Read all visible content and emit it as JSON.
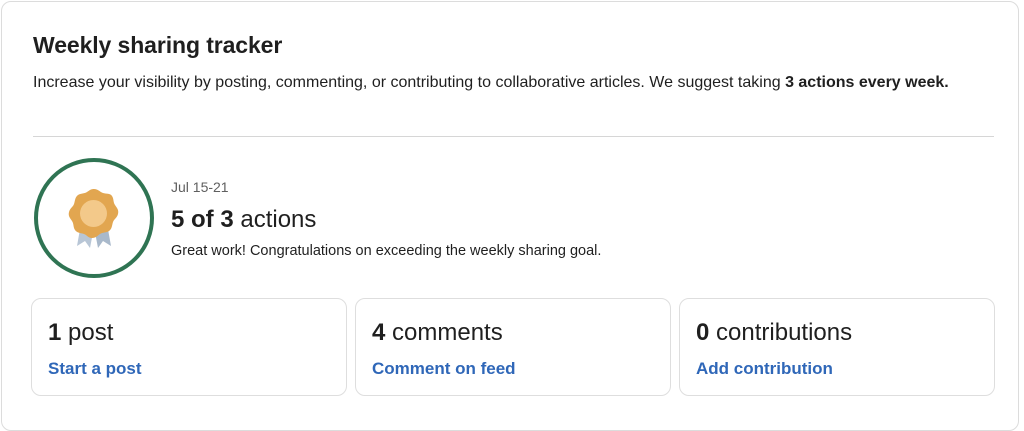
{
  "tracker": {
    "title": "Weekly sharing tracker",
    "description": "Increase your visibility by posting, commenting, or contributing to collaborative articles. We suggest taking ",
    "description_bold": "3 actions every week.",
    "period": "Jul 15-21",
    "actions_done": "5 of 3",
    "actions_label": "actions",
    "message": "Great work! Congratulations on exceeding the weekly sharing goal.",
    "badge_icon": "award-ribbon-icon",
    "colors": {
      "ring": "#2f7453",
      "medal": "#e2a650",
      "medal_center": "#f3c98a",
      "ribbon": "#b8c6d6",
      "link": "#2f67b8"
    }
  },
  "stats": [
    {
      "count": "1",
      "label": "post",
      "link": "Start a post"
    },
    {
      "count": "4",
      "label": "comments",
      "link": "Comment on feed"
    },
    {
      "count": "0",
      "label": "contributions",
      "link": "Add contribution"
    }
  ]
}
